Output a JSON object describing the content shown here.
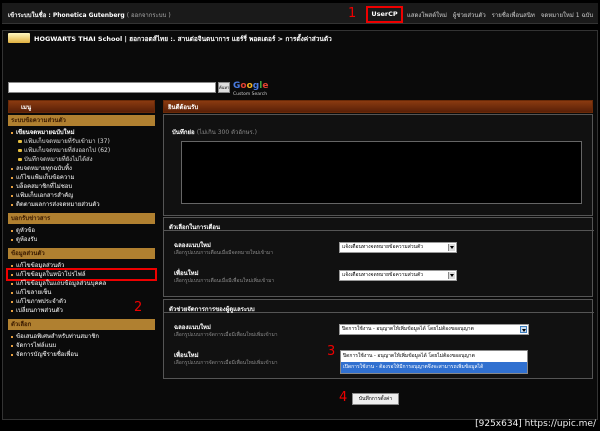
{
  "topbar": {
    "welcome_prefix": "เข้าระบบในชื่อ :",
    "username": "Phonetica Gutenberg",
    "logout": "( ออกจากระบบ )",
    "step1": "1",
    "usercp": "UserCP",
    "links": [
      "แสดงโพสต์ใหม่",
      "ผู้ช่วยส่วนตัว",
      "รายชื่อเพื่อนสนิท",
      "จดหมายใหม่ 1 ฉบับ"
    ]
  },
  "header": {
    "title": "HOGWARTS THAI School | ฮอกวอตส์ไทย :. สานต่อจินตนาการ แฮร์รี่ พอตเตอร์ > การตั้งค่าส่วนตัว"
  },
  "search": {
    "button": "ค้นหา",
    "google": [
      "G",
      "o",
      "o",
      "g",
      "l",
      "e"
    ],
    "google_sub": "Custom Search"
  },
  "sidebar": {
    "header": "เมนู",
    "sections": [
      {
        "title": "ระบบข้อความส่วนตัว",
        "items": [
          {
            "label": "เขียนจดหมายฉบับใหม่",
            "level": 0,
            "bold": true
          },
          {
            "label": "แฟ้มเก็บจดหมายที่รับเข้ามา (37)",
            "level": 1
          },
          {
            "label": "แฟ้มเก็บจดหมายที่ส่งออกไป (62)",
            "level": 1
          },
          {
            "label": "บันทึกจดหมายที่ยังไม่ได้ส่ง",
            "level": 1
          },
          {
            "label": "ลบจดหมายทุกฉบับทิ้ง",
            "level": 0
          },
          {
            "label": "แก้ไขแฟ้มเก็บข้อความ",
            "level": 0
          },
          {
            "label": "บล็อคสมาชิกที่ไม่ชอบ",
            "level": 0
          },
          {
            "label": "แฟ้มเก็บเอกสารสำคัญ",
            "level": 0
          },
          {
            "label": "ติดตามผลการส่งจดหมายส่วนตัว",
            "level": 0
          }
        ]
      },
      {
        "title": "บอกรับข่าวสาร",
        "items": [
          {
            "label": "ดูหัวข้อ",
            "level": 0
          },
          {
            "label": "ดูห้องรับ",
            "level": 0
          }
        ]
      },
      {
        "title": "ข้อมูลส่วนตัว",
        "items": [
          {
            "label": "แก้ไขข้อมูลส่วนตัว",
            "level": 0
          },
          {
            "label": "แก้ไขข้อมูลในหน้าโปรไฟล์",
            "level": 0
          },
          {
            "label": "แก้ไขข้อมูลในแถบข้อมูลส่วนบุคคล",
            "level": 0
          },
          {
            "label": "แก้ไขลายเซ็น",
            "level": 0
          },
          {
            "label": "แก้ไขภาพประจำตัว",
            "level": 0
          },
          {
            "label": "เปลี่ยนภาพส่วนตัว",
            "level": 0
          }
        ]
      },
      {
        "title": "ตัวเลือก",
        "items": [
          {
            "label": "ข้อเสนอพิเศษสำหรับท่านสมาชิก",
            "level": 0
          },
          {
            "label": "จัดการไฟล์แนบ",
            "level": 0
          },
          {
            "label": "จัดการบัญชีรายชื่อเพื่อน",
            "level": 0
          }
        ]
      }
    ],
    "step2": "2"
  },
  "main": {
    "header": "ยินดีต้อนรับ",
    "note_label": "บันทึกย่อ",
    "note_hint": "(ไม่เกิน 300 ตัวอักษร.)",
    "notify_title": "ตัวเลือกในการเตือน",
    "notify": [
      {
        "name": "ฉลองแนบใหม่",
        "desc": "เลือกรูปแบบการเตือนเมื่อมีจดหมายใหม่เข้ามา",
        "value": "แจ้งเตือนทางจดหมายข้อความส่วนตัว"
      },
      {
        "name": "เพื่อนใหม่",
        "desc": "เลือกรูปแบบการเตือนเมื่อมีเพื่อนใหม่เพิ่มเข้ามา",
        "value": "แจ้งเตือนทางจดหมายข้อความส่วนตัว"
      }
    ],
    "perm_title": "ตัวช่วยจัดการการของผู้ดูแลระบบ",
    "perm": [
      {
        "name": "ฉลองแนบใหม่",
        "desc": "เลือกรูปแบบการจัดการเมื่อมีเพื่อนใหม่เพิ่มเข้ามา",
        "value": "ปิดการใช้งาน - อนุญาตให้เพิ่มข้อมูลได้ โดยไม่ต้องขออนุญาต"
      },
      {
        "name": "เพื่อนใหม่",
        "desc": "เลือกรูปแบบการจัดการเมื่อมีเพื่อนใหม่เพิ่มเข้ามา",
        "value": ""
      }
    ],
    "dropdown_options": [
      "ปิดการใช้งาน - อนุญาตให้เพิ่มข้อมูลได้ โดยไม่ต้องขออนุญาต",
      "เปิดการใช้งาน - ต้องรอให้มีการอนุญาตจึงจะสามารถเพิ่มข้อมูลได้"
    ],
    "step3": "3",
    "step4": "4",
    "save_button": "บันทึกการตั้งค่า"
  },
  "watermark": "[925x634] https://upic.me/"
}
